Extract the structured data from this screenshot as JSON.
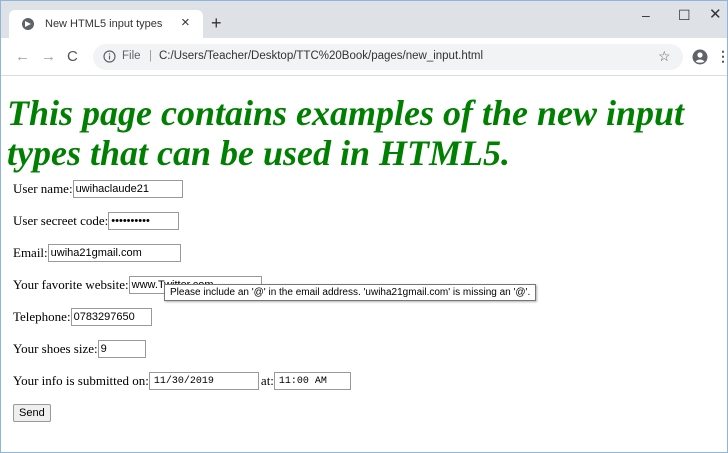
{
  "tab": {
    "title": "New HTML5 input types",
    "close_glyph": "×",
    "new_tab_glyph": "+"
  },
  "window_controls": {
    "minimize": "–",
    "maximize": "☐",
    "close": "✕"
  },
  "nav": {
    "back": "←",
    "forward": "→",
    "reload": "C"
  },
  "address_bar": {
    "scheme_label": "File",
    "separator": "|",
    "url": "C:/Users/Teacher/Desktop/TTC%20Book/pages/new_input.html"
  },
  "toolbar_icons": {
    "star": "☆",
    "menu": "⋮"
  },
  "page": {
    "heading": "This page contains examples of the new input types that can be used in HTML5.",
    "fields": {
      "username_label": "User name:",
      "username_value": "uwihaclaude21",
      "secret_label": "User secreet code:",
      "secret_value": "••••••••••",
      "email_label": "Email:",
      "email_value": "uwiha21gmail.com",
      "website_label": "Your favorite website:",
      "website_value": "www.Twitter.com",
      "telephone_label": "Telephone:",
      "telephone_value": "0783297650",
      "shoes_label": "Your shoes size:",
      "shoes_value": "9",
      "submitted_label": "Your info is submitted on:",
      "date_value": "11/30/2019",
      "at_label": "at:",
      "time_value": "11:00 AM"
    },
    "send_button": "Send",
    "validation_tooltip": "Please include an '@' in the email address. 'uwiha21gmail.com' is missing an '@'."
  }
}
